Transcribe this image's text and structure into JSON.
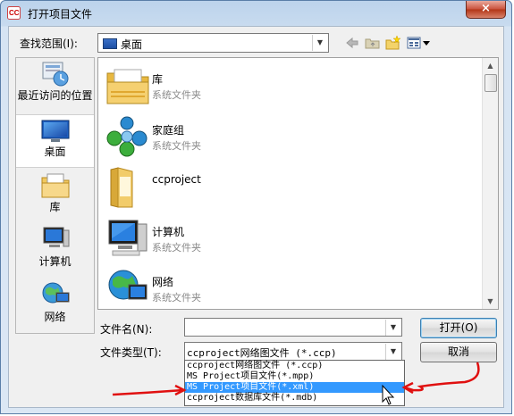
{
  "window": {
    "title": "打开项目文件",
    "close_label": "×"
  },
  "lookin": {
    "label": "查找范围(I):",
    "value": "桌面"
  },
  "toolbar": {
    "icons": [
      "back-arrow-icon",
      "up-folder-icon",
      "new-folder-icon",
      "view-menu-icon"
    ]
  },
  "sidebar": {
    "items": [
      {
        "label": "最近访问的位置",
        "icon": "recent-places-icon"
      },
      {
        "label": "桌面",
        "icon": "desktop-icon"
      },
      {
        "label": "库",
        "icon": "libraries-icon"
      },
      {
        "label": "计算机",
        "icon": "computer-icon"
      },
      {
        "label": "网络",
        "icon": "network-icon"
      }
    ]
  },
  "files": [
    {
      "name": "库",
      "type": "系统文件夹",
      "icon": "libraries-folder-icon"
    },
    {
      "name": "家庭组",
      "type": "系统文件夹",
      "icon": "homegroup-icon"
    },
    {
      "name": "ccproject",
      "type": "",
      "icon": "folder-icon"
    },
    {
      "name": "计算机",
      "type": "系统文件夹",
      "icon": "computer-icon"
    },
    {
      "name": "网络",
      "type": "系统文件夹",
      "icon": "network-icon"
    }
  ],
  "filename": {
    "label": "文件名(N):",
    "value": ""
  },
  "filetype": {
    "label": "文件类型(T):",
    "value": "ccproject网络图文件 (*.ccp)",
    "options": [
      "ccproject网络图文件 (*.ccp)",
      "MS Project项目文件(*.mpp)",
      "MS Project项目文件(*.xml)",
      "ccproject数据库文件(*.mdb)"
    ],
    "highlighted_index": 2
  },
  "buttons": {
    "open": "打开(O)",
    "cancel": "取消"
  },
  "colors": {
    "selection": "#3399ff",
    "annotation": "#e01010"
  }
}
